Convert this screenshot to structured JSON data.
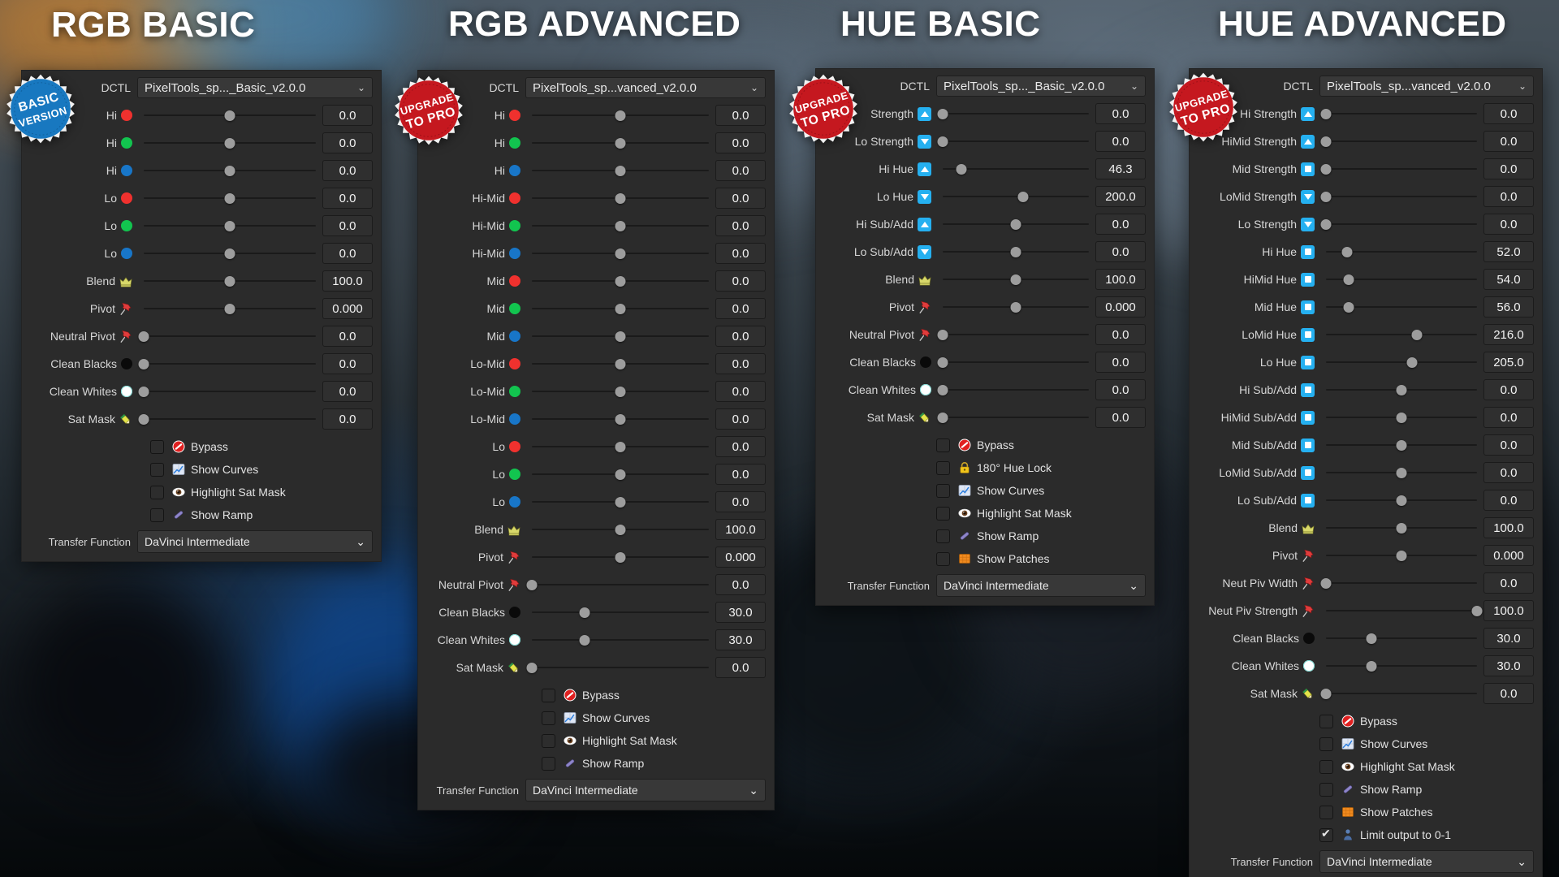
{
  "background": {
    "panel_bg": "#2b2b2b",
    "accent_blue": "#25b0f0",
    "badge_red": "#c5181f",
    "badge_blue": "#1878c0"
  },
  "columns": [
    {
      "title": "RGB BASIC",
      "badge": {
        "type": "basic",
        "line1": "BASIC",
        "line2": "VERSION"
      },
      "dctl": {
        "label": "DCTL",
        "value": "PixelTools_sp..._Basic_v2.0.0",
        "chevron": "⌄"
      },
      "rows": [
        {
          "label": "Hi",
          "icon": "dot-red",
          "value": "0.0",
          "pos": 50
        },
        {
          "label": "Hi",
          "icon": "dot-green",
          "value": "0.0",
          "pos": 50
        },
        {
          "label": "Hi",
          "icon": "dot-blue",
          "value": "0.0",
          "pos": 50
        },
        {
          "label": "Lo",
          "icon": "dot-red",
          "value": "0.0",
          "pos": 50
        },
        {
          "label": "Lo",
          "icon": "dot-green",
          "value": "0.0",
          "pos": 50
        },
        {
          "label": "Lo",
          "icon": "dot-blue",
          "value": "0.0",
          "pos": 50
        },
        {
          "label": "Blend",
          "icon": "crown-icon",
          "value": "100.0",
          "pos": 50
        },
        {
          "label": "Pivot",
          "icon": "pushpin-icon",
          "value": "0.000",
          "pos": 50
        },
        {
          "label": "Neutral Pivot",
          "icon": "pushpin-icon",
          "value": "0.0",
          "pos": 0
        },
        {
          "label": "Clean Blacks",
          "icon": "dot-black",
          "value": "0.0",
          "pos": 0
        },
        {
          "label": "Clean Whites",
          "icon": "dot-white",
          "value": "0.0",
          "pos": 0
        },
        {
          "label": "Sat Mask",
          "icon": "pencil-icon",
          "value": "0.0",
          "pos": 0
        }
      ],
      "checkboxes": [
        {
          "label": "Bypass",
          "icon": "no-entry-icon",
          "checked": false
        },
        {
          "label": "Show Curves",
          "icon": "chart-icon",
          "checked": false
        },
        {
          "label": "Highlight Sat Mask",
          "icon": "eye-icon",
          "checked": false
        },
        {
          "label": "Show Ramp",
          "icon": "ramp-icon",
          "checked": false
        }
      ],
      "transfer": {
        "label": "Transfer Function",
        "value": "DaVinci Intermediate",
        "chevron": "⌄"
      }
    },
    {
      "title": "RGB ADVANCED",
      "badge": {
        "type": "pro",
        "line1": "UPGRADE",
        "line2": "TO PRO"
      },
      "dctl": {
        "label": "DCTL",
        "value": "PixelTools_sp...vanced_v2.0.0",
        "chevron": "⌄"
      },
      "rows": [
        {
          "label": "Hi",
          "icon": "dot-red",
          "value": "0.0",
          "pos": 50
        },
        {
          "label": "Hi",
          "icon": "dot-green",
          "value": "0.0",
          "pos": 50
        },
        {
          "label": "Hi",
          "icon": "dot-blue",
          "value": "0.0",
          "pos": 50
        },
        {
          "label": "Hi-Mid",
          "icon": "dot-red",
          "value": "0.0",
          "pos": 50
        },
        {
          "label": "Hi-Mid",
          "icon": "dot-green",
          "value": "0.0",
          "pos": 50
        },
        {
          "label": "Hi-Mid",
          "icon": "dot-blue",
          "value": "0.0",
          "pos": 50
        },
        {
          "label": "Mid",
          "icon": "dot-red",
          "value": "0.0",
          "pos": 50
        },
        {
          "label": "Mid",
          "icon": "dot-green",
          "value": "0.0",
          "pos": 50
        },
        {
          "label": "Mid",
          "icon": "dot-blue",
          "value": "0.0",
          "pos": 50
        },
        {
          "label": "Lo-Mid",
          "icon": "dot-red",
          "value": "0.0",
          "pos": 50
        },
        {
          "label": "Lo-Mid",
          "icon": "dot-green",
          "value": "0.0",
          "pos": 50
        },
        {
          "label": "Lo-Mid",
          "icon": "dot-blue",
          "value": "0.0",
          "pos": 50
        },
        {
          "label": "Lo",
          "icon": "dot-red",
          "value": "0.0",
          "pos": 50
        },
        {
          "label": "Lo",
          "icon": "dot-green",
          "value": "0.0",
          "pos": 50
        },
        {
          "label": "Lo",
          "icon": "dot-blue",
          "value": "0.0",
          "pos": 50
        },
        {
          "label": "Blend",
          "icon": "crown-icon",
          "value": "100.0",
          "pos": 50
        },
        {
          "label": "Pivot",
          "icon": "pushpin-icon",
          "value": "0.000",
          "pos": 50
        },
        {
          "label": "Neutral Pivot",
          "icon": "pushpin-icon",
          "value": "0.0",
          "pos": 0
        },
        {
          "label": "Clean Blacks",
          "icon": "dot-black",
          "value": "30.0",
          "pos": 30
        },
        {
          "label": "Clean Whites",
          "icon": "dot-white",
          "value": "30.0",
          "pos": 30
        },
        {
          "label": "Sat Mask",
          "icon": "pencil-icon",
          "value": "0.0",
          "pos": 0
        }
      ],
      "checkboxes": [
        {
          "label": "Bypass",
          "icon": "no-entry-icon",
          "checked": false
        },
        {
          "label": "Show Curves",
          "icon": "chart-icon",
          "checked": false
        },
        {
          "label": "Highlight Sat Mask",
          "icon": "eye-icon",
          "checked": false
        },
        {
          "label": "Show Ramp",
          "icon": "ramp-icon",
          "checked": false
        }
      ],
      "transfer": {
        "label": "Transfer Function",
        "value": "DaVinci Intermediate",
        "chevron": "⌄"
      }
    },
    {
      "title": "HUE BASIC",
      "badge": {
        "type": "pro",
        "line1": "UPGRADE",
        "line2": "TO PRO"
      },
      "dctl": {
        "label": "DCTL",
        "value": "PixelTools_sp..._Basic_v2.0.0",
        "chevron": "⌄"
      },
      "rows": [
        {
          "label": "Strength",
          "icon": "tri-up",
          "value": "0.0",
          "pos": 0
        },
        {
          "label": "Lo Strength",
          "icon": "tri-down",
          "value": "0.0",
          "pos": 0
        },
        {
          "label": "Hi Hue",
          "icon": "tri-up",
          "value": "46.3",
          "pos": 13
        },
        {
          "label": "Lo Hue",
          "icon": "tri-down",
          "value": "200.0",
          "pos": 55
        },
        {
          "label": "Hi Sub/Add",
          "icon": "tri-up",
          "value": "0.0",
          "pos": 50
        },
        {
          "label": "Lo Sub/Add",
          "icon": "tri-down",
          "value": "0.0",
          "pos": 50
        },
        {
          "label": "Blend",
          "icon": "crown-icon",
          "value": "100.0",
          "pos": 50
        },
        {
          "label": "Pivot",
          "icon": "pushpin-icon",
          "value": "0.000",
          "pos": 50
        },
        {
          "label": "Neutral Pivot",
          "icon": "pushpin-icon",
          "value": "0.0",
          "pos": 0
        },
        {
          "label": "Clean Blacks",
          "icon": "dot-black",
          "value": "0.0",
          "pos": 0
        },
        {
          "label": "Clean Whites",
          "icon": "dot-white",
          "value": "0.0",
          "pos": 0
        },
        {
          "label": "Sat Mask",
          "icon": "pencil-icon",
          "value": "0.0",
          "pos": 0
        }
      ],
      "checkboxes": [
        {
          "label": "Bypass",
          "icon": "no-entry-icon",
          "checked": false
        },
        {
          "label": "180° Hue Lock",
          "icon": "lock-icon",
          "checked": false
        },
        {
          "label": "Show Curves",
          "icon": "chart-icon",
          "checked": false
        },
        {
          "label": "Highlight Sat Mask",
          "icon": "eye-icon",
          "checked": false
        },
        {
          "label": "Show Ramp",
          "icon": "ramp-icon",
          "checked": false
        },
        {
          "label": "Show Patches",
          "icon": "patches-icon",
          "checked": false
        }
      ],
      "transfer": {
        "label": "Transfer Function",
        "value": "DaVinci Intermediate",
        "chevron": "⌄"
      }
    },
    {
      "title": "HUE ADVANCED",
      "badge": {
        "type": "pro",
        "line1": "UPGRADE",
        "line2": "TO PRO"
      },
      "dctl": {
        "label": "DCTL",
        "value": "PixelTools_sp...vanced_v2.0.0",
        "chevron": "⌄"
      },
      "rows": [
        {
          "label": "Hi Strength",
          "icon": "tri-up",
          "value": "0.0",
          "pos": 0
        },
        {
          "label": "HiMid Strength",
          "icon": "tri-up",
          "value": "0.0",
          "pos": 0
        },
        {
          "label": "Mid Strength",
          "icon": "sq-mid",
          "value": "0.0",
          "pos": 0
        },
        {
          "label": "LoMid Strength",
          "icon": "tri-down",
          "value": "0.0",
          "pos": 0
        },
        {
          "label": "Lo Strength",
          "icon": "tri-down",
          "value": "0.0",
          "pos": 0
        },
        {
          "label": "Hi Hue",
          "icon": "sq-mid",
          "value": "52.0",
          "pos": 14
        },
        {
          "label": "HiMid Hue",
          "icon": "sq-mid",
          "value": "54.0",
          "pos": 15
        },
        {
          "label": "Mid Hue",
          "icon": "sq-mid",
          "value": "56.0",
          "pos": 15
        },
        {
          "label": "LoMid Hue",
          "icon": "sq-mid",
          "value": "216.0",
          "pos": 60
        },
        {
          "label": "Lo Hue",
          "icon": "sq-mid",
          "value": "205.0",
          "pos": 57
        },
        {
          "label": "Hi Sub/Add",
          "icon": "sq-mid",
          "value": "0.0",
          "pos": 50
        },
        {
          "label": "HiMid Sub/Add",
          "icon": "sq-mid",
          "value": "0.0",
          "pos": 50
        },
        {
          "label": "Mid Sub/Add",
          "icon": "sq-mid",
          "value": "0.0",
          "pos": 50
        },
        {
          "label": "LoMid Sub/Add",
          "icon": "sq-mid",
          "value": "0.0",
          "pos": 50
        },
        {
          "label": "Lo Sub/Add",
          "icon": "sq-mid",
          "value": "0.0",
          "pos": 50
        },
        {
          "label": "Blend",
          "icon": "crown-icon",
          "value": "100.0",
          "pos": 50
        },
        {
          "label": "Pivot",
          "icon": "pushpin-icon",
          "value": "0.000",
          "pos": 50
        },
        {
          "label": "Neut Piv Width",
          "icon": "pushpin-icon",
          "value": "0.0",
          "pos": 0
        },
        {
          "label": "Neut Piv Strength",
          "icon": "pushpin-icon",
          "value": "100.0",
          "pos": 100
        },
        {
          "label": "Clean Blacks",
          "icon": "dot-black",
          "value": "30.0",
          "pos": 30
        },
        {
          "label": "Clean Whites",
          "icon": "dot-white",
          "value": "30.0",
          "pos": 30
        },
        {
          "label": "Sat Mask",
          "icon": "pencil-icon",
          "value": "0.0",
          "pos": 0
        }
      ],
      "checkboxes": [
        {
          "label": "Bypass",
          "icon": "no-entry-icon",
          "checked": false
        },
        {
          "label": "Show Curves",
          "icon": "chart-icon",
          "checked": false
        },
        {
          "label": "Highlight Sat Mask",
          "icon": "eye-icon",
          "checked": false
        },
        {
          "label": "Show Ramp",
          "icon": "ramp-icon",
          "checked": false
        },
        {
          "label": "Show Patches",
          "icon": "patches-icon",
          "checked": false
        },
        {
          "label": "Limit output to 0-1",
          "icon": "person-icon",
          "checked": true
        }
      ],
      "transfer": {
        "label": "Transfer Function",
        "value": "DaVinci Intermediate",
        "chevron": "⌄"
      }
    }
  ]
}
